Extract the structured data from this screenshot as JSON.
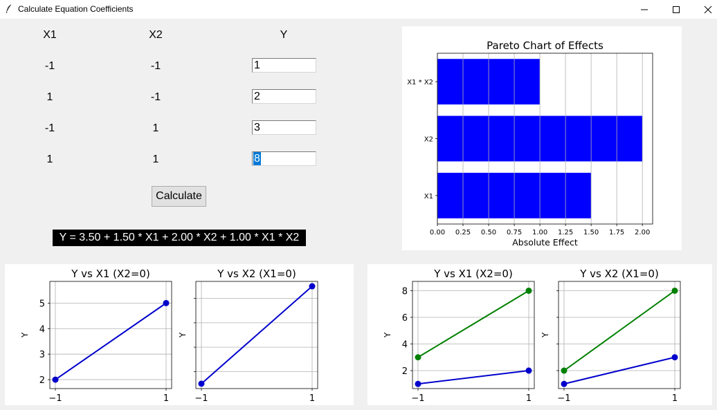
{
  "window": {
    "title": "Calculate Equation Coefficients",
    "controls": [
      "minimize",
      "maximize",
      "close"
    ]
  },
  "table": {
    "headers": [
      "X1",
      "X2",
      "Y"
    ],
    "rows": [
      {
        "x1": "-1",
        "x2": "-1",
        "y": "1"
      },
      {
        "x1": "1",
        "x2": "-1",
        "y": "2"
      },
      {
        "x1": "-1",
        "x2": "1",
        "y": "3"
      },
      {
        "x1": "1",
        "x2": "1",
        "y": "8"
      }
    ]
  },
  "calculate_label": "Calculate",
  "equation": "Y = 3.50 + 1.50 * X1 + 2.00 * X2 + 1.00 * X1 * X2",
  "colors": {
    "blue": "#0000ff",
    "line_blue": "#0000cc",
    "green": "#008000",
    "grid": "#b0b0b0"
  },
  "chart_data": [
    {
      "type": "bar",
      "orientation": "horizontal",
      "title": "Pareto Chart of Effects",
      "xlabel": "Absolute Effect",
      "ylabel": "",
      "categories": [
        "X1",
        "X2",
        "X1 * X2"
      ],
      "values": [
        1.5,
        2.0,
        1.0
      ],
      "xlim": [
        0,
        2.1
      ],
      "xticks": [
        "0.00",
        "0.25",
        "0.50",
        "0.75",
        "1.00",
        "1.25",
        "1.50",
        "1.75",
        "2.00"
      ],
      "grid": "vertical",
      "color": "#0000ff"
    },
    {
      "type": "line",
      "title": "Y vs X1 (X2=0)",
      "xlabel": "",
      "ylabel": "Y",
      "xticks": [
        "−1",
        "1"
      ],
      "yticks": [
        "2",
        "3",
        "4",
        "5"
      ],
      "xlim": [
        -1.1,
        1.1
      ],
      "ylim": [
        1.65,
        5.85
      ],
      "series": [
        {
          "x": [
            -1,
            1
          ],
          "y": [
            2,
            5
          ],
          "color": "#0000cc"
        }
      ]
    },
    {
      "type": "line",
      "title": "Y vs X2 (X1=0)",
      "xlabel": "",
      "ylabel": "Y",
      "xticks": [
        "−1",
        "1"
      ],
      "yticks": [],
      "xlim": [
        -1.1,
        1.1
      ],
      "ylim": [
        1.3,
        5.7
      ],
      "series": [
        {
          "x": [
            -1,
            1
          ],
          "y": [
            1.5,
            5.5
          ],
          "color": "#0000cc"
        }
      ]
    },
    {
      "type": "line",
      "title": "Y vs X1 (X2=0)",
      "xlabel": "",
      "ylabel": "Y",
      "xticks": [
        "−1",
        "1"
      ],
      "yticks": [
        "2",
        "4",
        "6",
        "8"
      ],
      "xlim": [
        -1.1,
        1.1
      ],
      "ylim": [
        0.65,
        8.7
      ],
      "series": [
        {
          "x": [
            -1,
            1
          ],
          "y": [
            1,
            2
          ],
          "color": "#0000cc"
        },
        {
          "x": [
            -1,
            1
          ],
          "y": [
            3,
            8
          ],
          "color": "#008000"
        }
      ]
    },
    {
      "type": "line",
      "title": "Y vs X2 (X1=0)",
      "xlabel": "",
      "ylabel": "Y",
      "xticks": [
        "−1",
        "1"
      ],
      "yticks": [],
      "xlim": [
        -1.1,
        1.1
      ],
      "ylim": [
        0.65,
        8.7
      ],
      "series": [
        {
          "x": [
            -1,
            1
          ],
          "y": [
            1,
            3
          ],
          "color": "#0000cc"
        },
        {
          "x": [
            -1,
            1
          ],
          "y": [
            2,
            8
          ],
          "color": "#008000"
        }
      ]
    }
  ]
}
